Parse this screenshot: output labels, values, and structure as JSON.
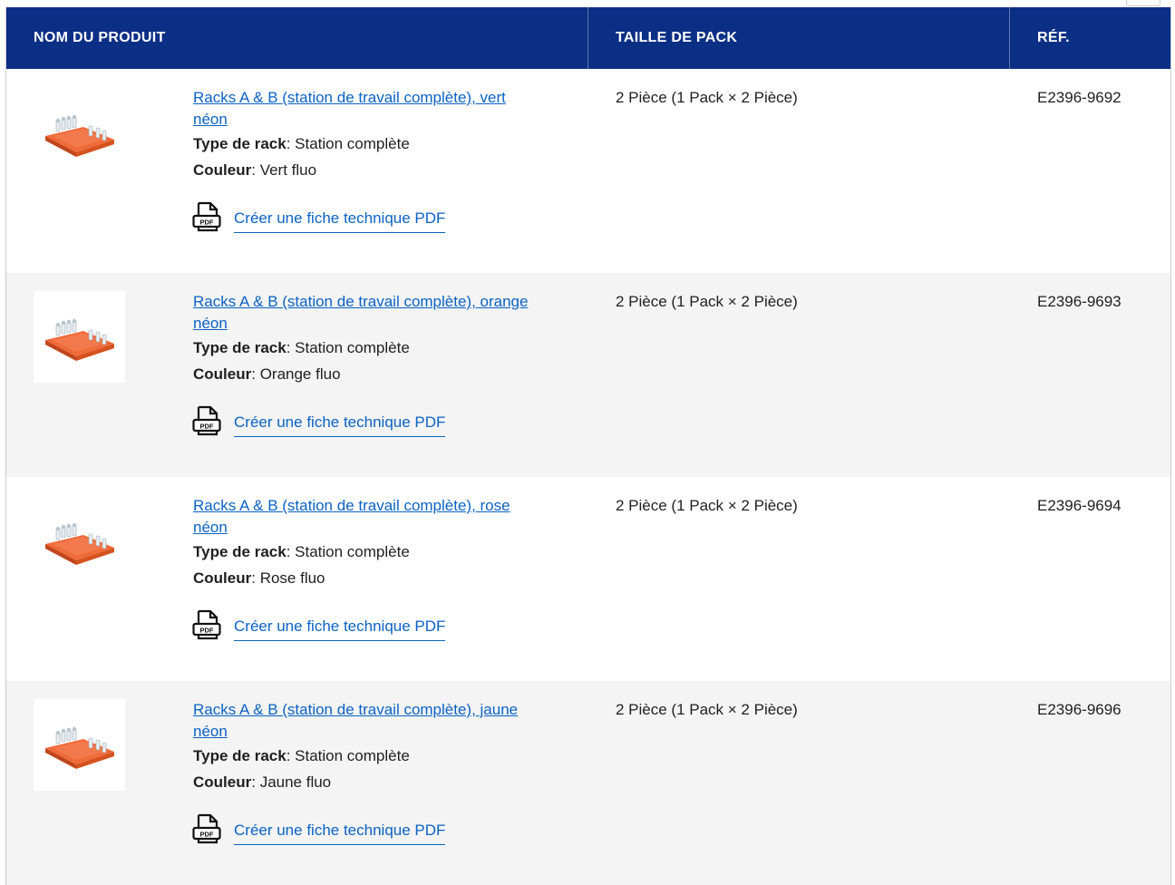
{
  "table": {
    "headers": {
      "name": "NOM DU PRODUIT",
      "pack": "TAILLE DE PACK",
      "ref": "RÉF."
    },
    "attr_labels": {
      "rack_type": "Type de rack",
      "color": "Couleur"
    },
    "rows": [
      {
        "name": "Racks A & B (station de travail complète), vert néon",
        "rack_type": "Station complète",
        "color": "Vert fluo",
        "pdf_label": "Créer une fiche technique PDF",
        "pack_size": "2 Pièce (1 Pack × 2 Pièce)",
        "ref": "E2396-9692"
      },
      {
        "name": "Racks A & B (station de travail complète), orange néon",
        "rack_type": "Station complète",
        "color": "Orange fluo",
        "pdf_label": "Créer une fiche technique PDF",
        "pack_size": "2 Pièce (1 Pack × 2 Pièce)",
        "ref": "E2396-9693"
      },
      {
        "name": "Racks A & B (station de travail complète), rose néon",
        "rack_type": "Station complète",
        "color": "Rose fluo",
        "pdf_label": "Créer une fiche technique PDF",
        "pack_size": "2 Pièce (1 Pack × 2 Pièce)",
        "ref": "E2396-9694"
      },
      {
        "name": "Racks A & B (station de travail complète), jaune néon",
        "rack_type": "Station complète",
        "color": "Jaune fluo",
        "pdf_label": "Créer une fiche technique PDF",
        "pack_size": "2 Pièce (1 Pack × 2 Pièce)",
        "ref": "E2396-9696"
      }
    ]
  },
  "icons": {
    "product_thumbnail": "rack-thumbnail-icon",
    "pdf": "pdf-file-icon"
  },
  "colors": {
    "header_bg": "#0b2f85",
    "link": "#0b62c4",
    "alt_row_bg": "#f4f4f4",
    "rack_orange": "#e8582a"
  }
}
